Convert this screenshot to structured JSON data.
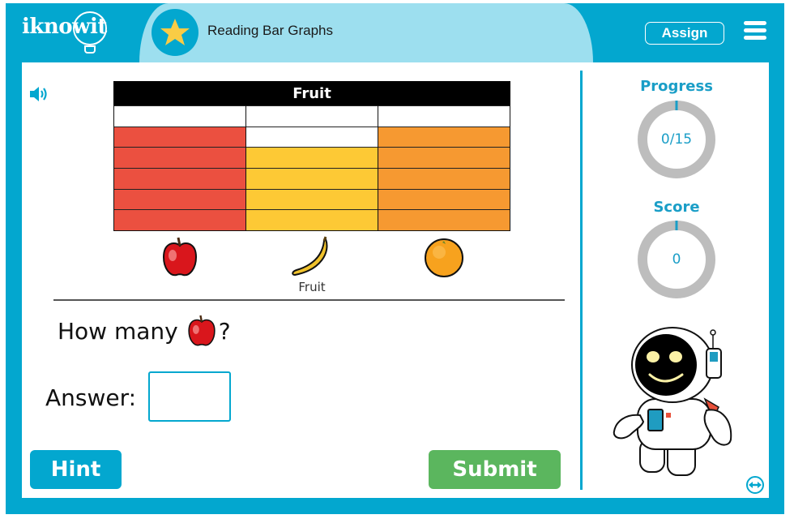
{
  "header": {
    "logo": "iknowit",
    "title": "Reading Bar Graphs",
    "title_icon": "star-icon",
    "assign_label": "Assign",
    "menu_icon": "hamburger-menu-icon"
  },
  "colors": {
    "brand": "#03a7cf",
    "title_bg": "#9ddfef",
    "star": "#f9cc45",
    "submit": "#5bb65e",
    "apple_bar": "#eb5040",
    "banana_bar": "#fdc935",
    "orange_bar": "#f69931"
  },
  "question_area": {
    "audio_icon": "speaker-icon",
    "question_prefix": "How many",
    "question_subject_icon": "apple-icon",
    "question_suffix": "?",
    "answer_label": "Answer:",
    "answer_value": "",
    "hint_label": "Hint",
    "submit_label": "Submit"
  },
  "chart_data": {
    "type": "bar",
    "title": "Fruit",
    "xlabel": "Fruit",
    "ylabel": "",
    "categories": [
      "Apple",
      "Banana",
      "Orange"
    ],
    "category_icons": [
      "apple-icon",
      "banana-icon",
      "orange-icon"
    ],
    "values": [
      5,
      4,
      5
    ],
    "ylim": [
      0,
      6
    ],
    "grid": true,
    "orientation": "vertical",
    "colors": [
      "#eb5040",
      "#fdc935",
      "#f69931"
    ]
  },
  "sidebar": {
    "progress_label": "Progress",
    "progress_value": "0/15",
    "progress_fraction": 0,
    "score_label": "Score",
    "score_value": "0",
    "score_fraction": 0,
    "mascot": "astronaut-robot-mascot",
    "expand_icon": "expand-arrows-icon"
  }
}
